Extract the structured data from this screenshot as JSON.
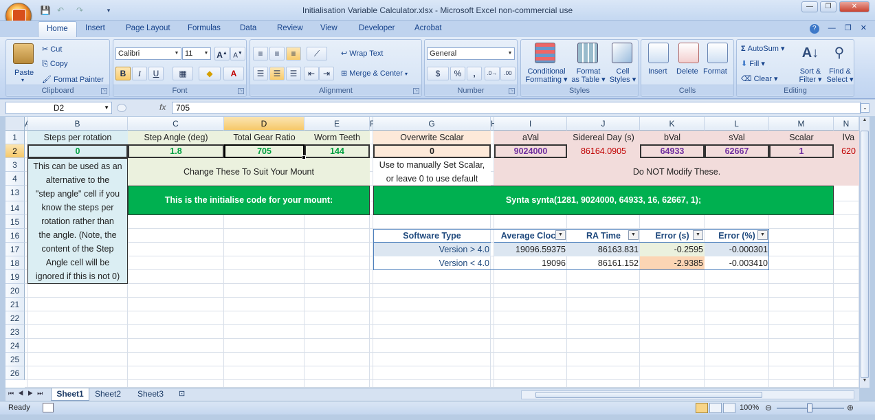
{
  "window": {
    "title": "Initialisation Variable Calculator.xlsx - Microsoft Excel non-commercial use",
    "minimize": "—",
    "restore": "❐",
    "close": "✕"
  },
  "ribbon_tabs": [
    "Home",
    "Insert",
    "Page Layout",
    "Formulas",
    "Data",
    "Review",
    "View",
    "Developer",
    "Acrobat"
  ],
  "ribbon": {
    "clipboard": {
      "label": "Clipboard",
      "paste": "Paste",
      "cut": "Cut",
      "copy": "Copy",
      "format_painter": "Format Painter"
    },
    "font": {
      "label": "Font",
      "font_name": "Calibri",
      "font_size": "11",
      "bold": "B",
      "italic": "I",
      "underline": "U"
    },
    "alignment": {
      "label": "Alignment",
      "wrap_text": "Wrap Text",
      "merge_center": "Merge & Center"
    },
    "number": {
      "label": "Number",
      "format": "General",
      "percent": "%",
      "comma": ","
    },
    "styles": {
      "label": "Styles",
      "conditional_1": "Conditional",
      "conditional_2": "Formatting",
      "format_table_1": "Format",
      "format_table_2": "as Table",
      "cell_styles_1": "Cell",
      "cell_styles_2": "Styles"
    },
    "cells": {
      "label": "Cells",
      "insert": "Insert",
      "delete": "Delete",
      "format": "Format"
    },
    "editing": {
      "label": "Editing",
      "autosum": "AutoSum",
      "fill": "Fill",
      "clear": "Clear",
      "sort_1": "Sort &",
      "sort_2": "Filter",
      "find_1": "Find &",
      "find_2": "Select"
    }
  },
  "formula_bar": {
    "name_box": "D2",
    "fx": "fx",
    "formula": "705"
  },
  "columns": [
    "A",
    "B",
    "C",
    "D",
    "E",
    "F",
    "G",
    "H",
    "I",
    "J",
    "K",
    "L",
    "M",
    "N"
  ],
  "rows": [
    "1",
    "2",
    "3",
    "4",
    "13",
    "14",
    "15",
    "16",
    "17",
    "18",
    "19",
    "20",
    "21",
    "22",
    "23",
    "24",
    "25",
    "26"
  ],
  "cells": {
    "B1": "Steps per rotation",
    "C1": "Step Angle (deg)",
    "D1": "Total Gear Ratio",
    "E1": "Worm Teeth",
    "G1": "Overwrite Scalar",
    "I1": "aVal",
    "J1": "Sidereal Day (s)",
    "K1": "bVal",
    "L1": "sVal",
    "M1": "Scalar",
    "N1": "lVa",
    "B2": "0",
    "C2": "1.8",
    "D2": "705",
    "E2": "144",
    "G2": "0",
    "I2": "9024000",
    "J2": "86164.0905",
    "K2": "64933",
    "L2": "62667",
    "M2": "1",
    "N2": "620",
    "B3_lines": [
      "This can be used as an",
      "alternative to the",
      "\"step angle\" cell if you",
      "know the steps per",
      "rotation rather than",
      "the angle. (Note, the",
      "content of the Step",
      "Angle cell will be",
      "ignored if this is not 0)"
    ],
    "C3": "Change These To Suit Your Mount",
    "G3": "Use to manually Set Scalar,",
    "G4": "or leave 0 to use default",
    "I3": "Do NOT Modify These.",
    "C13": "This is the initialise code for your mount:",
    "G13": "Synta synta(1281, 9024000, 64933, 16, 62667, 1);",
    "table_headers": [
      "Software Type",
      "Average Clock",
      "RA Time",
      "Error (s)",
      "Error (%)"
    ],
    "table_rows": [
      [
        "Version > 4.0",
        "19096.59375",
        "86163.831",
        "-0.2595",
        "-0.000301"
      ],
      [
        "Version < 4.0",
        "19096",
        "86161.152",
        "-2.9385",
        "-0.003410"
      ]
    ]
  },
  "sheets": [
    "Sheet1",
    "Sheet2",
    "Sheet3"
  ],
  "status": {
    "ready": "Ready",
    "zoom": "100%"
  },
  "colors": {
    "accent_green": "#00b050",
    "light_green": "#ebf1de",
    "peach": "#fde9d9",
    "pink": "#f2dcdb",
    "lightblue": "#dbeef3",
    "selected_orange": "#f6c869"
  }
}
